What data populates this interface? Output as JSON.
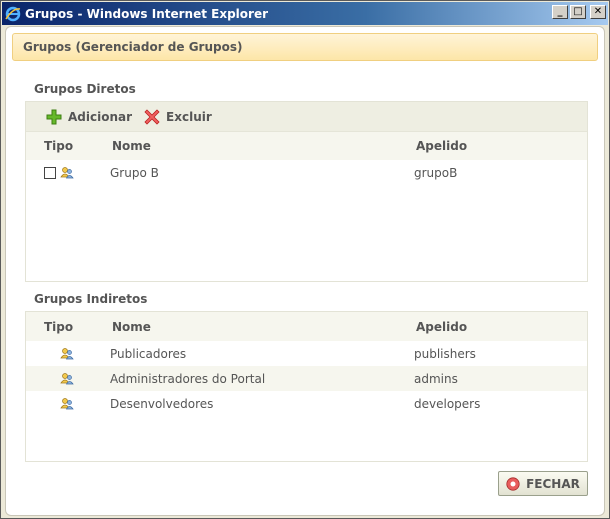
{
  "window": {
    "title": "Grupos - Windows Internet Explorer",
    "minimize_symbol": "_",
    "maximize_symbol": "□",
    "close_symbol": "✕"
  },
  "dialog": {
    "header": "Grupos (Gerenciador de Grupos)"
  },
  "direct": {
    "title": "Grupos Diretos",
    "add_label": "Adicionar",
    "delete_label": "Excluir",
    "columns": {
      "tipo": "Tipo",
      "nome": "Nome",
      "apelido": "Apelido"
    },
    "rows": [
      {
        "nome": "Grupo B",
        "apelido": "grupoB",
        "checked": false
      }
    ]
  },
  "indirect": {
    "title": "Grupos Indiretos",
    "columns": {
      "tipo": "Tipo",
      "nome": "Nome",
      "apelido": "Apelido"
    },
    "rows": [
      {
        "nome": "Publicadores",
        "apelido": "publishers"
      },
      {
        "nome": "Administradores do Portal",
        "apelido": "admins"
      },
      {
        "nome": "Desenvolvedores",
        "apelido": "developers"
      }
    ]
  },
  "footer": {
    "close_label": "FECHAR"
  },
  "icons": {
    "app": "ie-icon",
    "add": "plus-icon",
    "delete": "x-icon",
    "group": "group-icon",
    "close": "close-circle-icon"
  },
  "colors": {
    "header_bg": "#fde6a8",
    "toolbar_bg": "#eeeee2",
    "title_bar": "#0a246a"
  }
}
